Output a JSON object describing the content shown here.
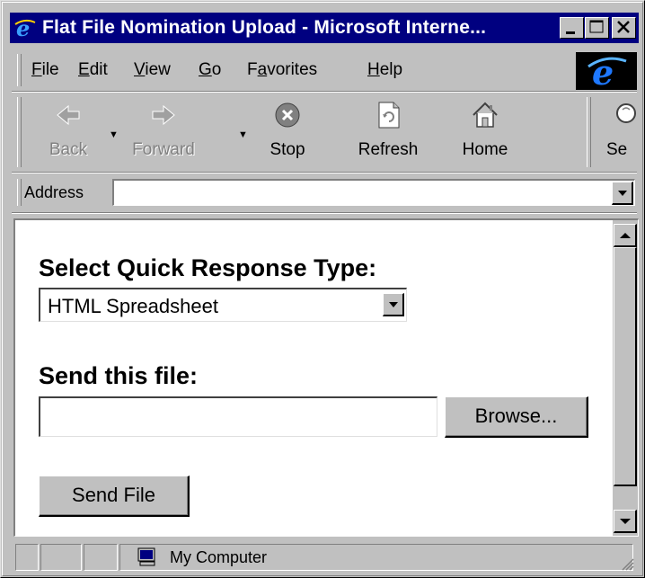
{
  "window": {
    "title": "Flat File Nomination Upload - Microsoft Interne..."
  },
  "menu": [
    "File",
    "Edit",
    "View",
    "Go",
    "Favorites",
    "Help"
  ],
  "menu_access_keys": [
    "F",
    "E",
    "V",
    "G",
    "a",
    "H"
  ],
  "toolbar": [
    {
      "label": "Back",
      "icon": "back-arrow-icon",
      "enabled": false
    },
    {
      "label": "Forward",
      "icon": "forward-arrow-icon",
      "enabled": false
    },
    {
      "label": "Stop",
      "icon": "stop-icon",
      "enabled": true
    },
    {
      "label": "Refresh",
      "icon": "refresh-icon",
      "enabled": true
    },
    {
      "label": "Home",
      "icon": "home-icon",
      "enabled": true
    },
    {
      "label": "Se",
      "icon": "search-icon",
      "enabled": true
    }
  ],
  "address": {
    "label": "Address",
    "value": ""
  },
  "form": {
    "response_type_label": "Select Quick Response Type:",
    "response_type_value": "HTML Spreadsheet",
    "file_label": "Send this file:",
    "file_value": "",
    "browse_label": "Browse...",
    "send_label": "Send File"
  },
  "status": {
    "zone": "My Computer"
  },
  "colors": {
    "titlebar": "#000080",
    "chrome": "#c0c0c0",
    "content_bg": "#ffffff"
  }
}
